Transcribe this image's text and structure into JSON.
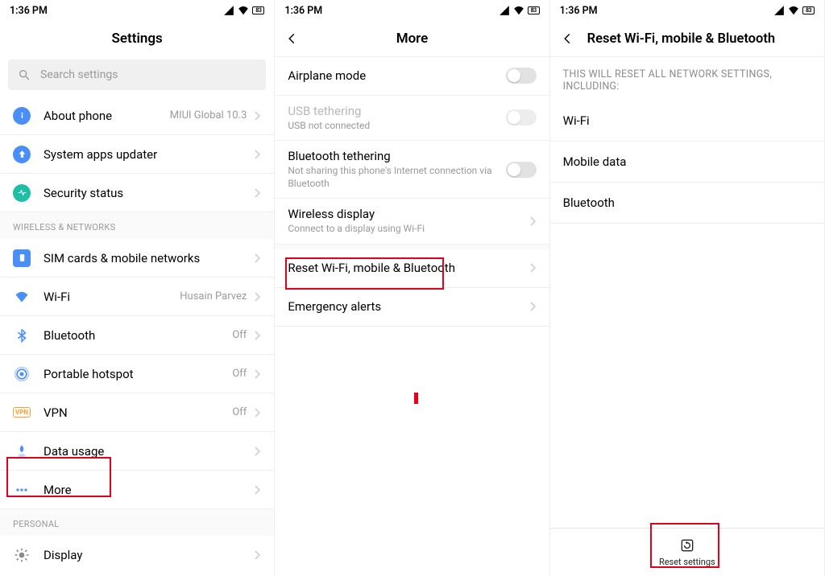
{
  "status": {
    "time": "1:36 PM",
    "battery": "83"
  },
  "panel1": {
    "title": "Settings",
    "search_placeholder": "Search settings",
    "items_top": [
      {
        "name": "about-phone",
        "label": "About phone",
        "value": "MIUI Global 10.3",
        "icon": "info",
        "color": "#4a8ff7"
      },
      {
        "name": "system-apps-updater",
        "label": "System apps updater",
        "value": "",
        "icon": "arrow-up",
        "color": "#4a8ff7"
      },
      {
        "name": "security-status",
        "label": "Security status",
        "value": "",
        "icon": "heartbeat",
        "color": "#1fbfa6"
      }
    ],
    "section_wireless": "WIRELESS & NETWORKS",
    "items_wireless": [
      {
        "name": "sim-cards",
        "label": "SIM cards & mobile networks",
        "value": "",
        "icon": "sim",
        "color": "#4a8ff7"
      },
      {
        "name": "wifi",
        "label": "Wi-Fi",
        "value": "Husain Parvez",
        "icon": "wifi",
        "color": "#4a8ff7"
      },
      {
        "name": "bluetooth",
        "label": "Bluetooth",
        "value": "Off",
        "icon": "bluetooth",
        "color": "#4a8ff7"
      },
      {
        "name": "portable-hotspot",
        "label": "Portable hotspot",
        "value": "Off",
        "icon": "hotspot",
        "color": "#4a8ff7"
      },
      {
        "name": "vpn",
        "label": "VPN",
        "value": "Off",
        "icon": "vpn",
        "color": "#ff9e2c"
      },
      {
        "name": "data-usage",
        "label": "Data usage",
        "value": "",
        "icon": "data",
        "color": "#4a8ff7"
      },
      {
        "name": "more",
        "label": "More",
        "value": "",
        "icon": "dots",
        "color": "#4a8ff7"
      }
    ],
    "section_personal": "PERSONAL",
    "items_personal": [
      {
        "name": "display",
        "label": "Display",
        "value": "",
        "icon": "brightness",
        "color": "#8a8a8a"
      }
    ]
  },
  "panel2": {
    "title": "More",
    "rows": [
      {
        "name": "airplane-mode",
        "label": "Airplane mode",
        "sub": "",
        "toggle": true,
        "disabled": false
      },
      {
        "name": "usb-tethering",
        "label": "USB tethering",
        "sub": "USB not connected",
        "toggle": true,
        "disabled": true
      },
      {
        "name": "bluetooth-tethering",
        "label": "Bluetooth tethering",
        "sub": "Not sharing this phone's Internet connection via Bluetooth",
        "toggle": true,
        "disabled": false
      },
      {
        "name": "wireless-display",
        "label": "Wireless display",
        "sub": "Connect to a display using Wi-Fi",
        "chevron": true
      },
      {
        "name": "reset-network",
        "label": "Reset Wi-Fi, mobile & Bluetooth",
        "sub": "",
        "chevron": true
      },
      {
        "name": "emergency-alerts",
        "label": "Emergency alerts",
        "sub": "",
        "chevron": true
      }
    ]
  },
  "panel3": {
    "title": "Reset Wi-Fi, mobile & Bluetooth",
    "description": "THIS WILL RESET ALL NETWORK SETTINGS, INCLUDING:",
    "items": [
      "Wi-Fi",
      "Mobile data",
      "Bluetooth"
    ],
    "button": "Reset settings"
  }
}
